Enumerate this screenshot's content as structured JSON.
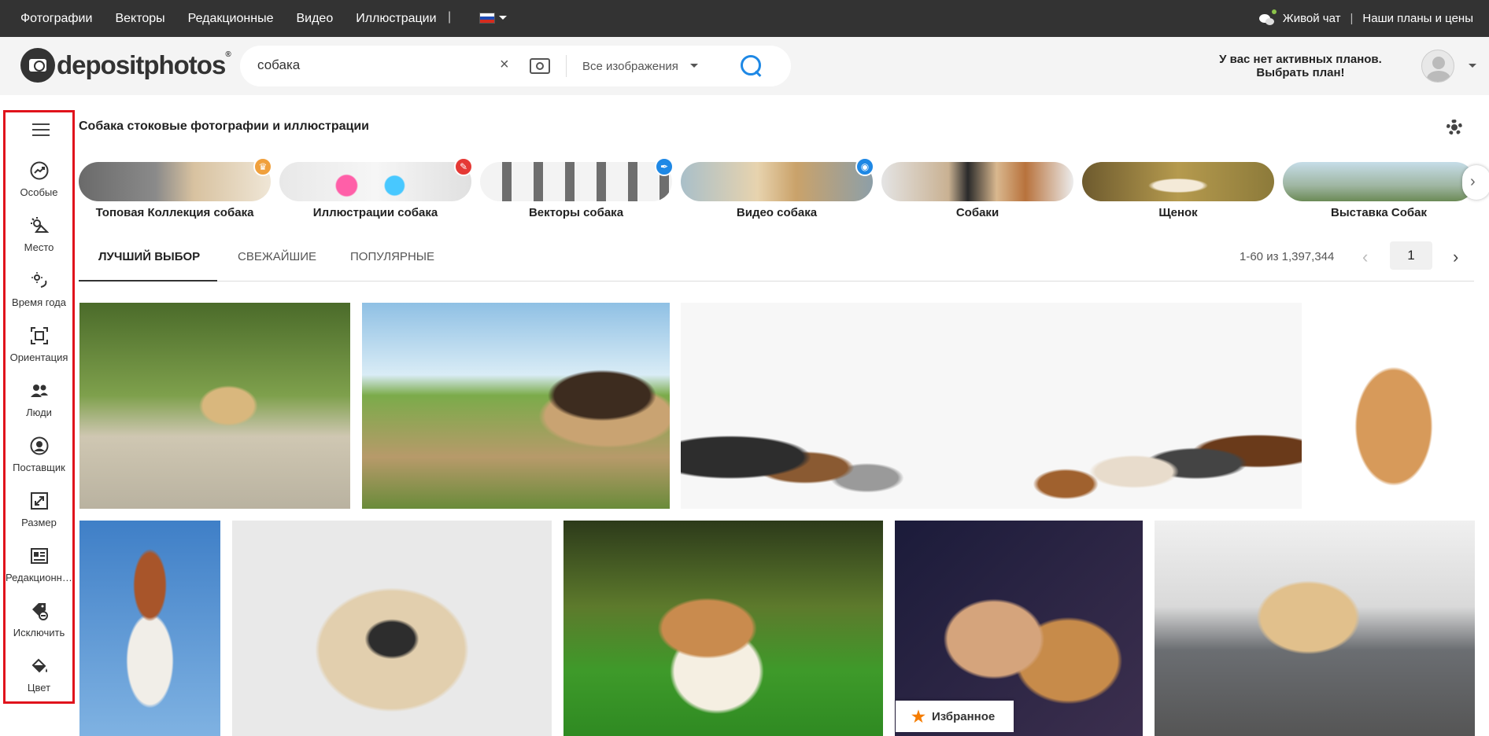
{
  "topnav": {
    "items": [
      "Фотографии",
      "Векторы",
      "Редакционные",
      "Видео",
      "Иллюстрации"
    ],
    "separator": "|",
    "live_chat": "Живой чат",
    "plans": "Наши планы и цены"
  },
  "header": {
    "logo_text": "depositphotos",
    "logo_mark": "®",
    "search_value": "собака",
    "clear_symbol": "×",
    "filter_label": "Все изображения",
    "plan_line1": "У вас нет активных планов.",
    "plan_line2": "Выбрать план!"
  },
  "sidebar": {
    "items": [
      {
        "label": "Особые",
        "icon": "trending-icon"
      },
      {
        "label": "Место",
        "icon": "weather-icon"
      },
      {
        "label": "Время года",
        "icon": "season-icon"
      },
      {
        "label": "Ориентация",
        "icon": "orientation-icon"
      },
      {
        "label": "Люди",
        "icon": "people-icon"
      },
      {
        "label": "Поставщик",
        "icon": "contributor-icon"
      },
      {
        "label": "Размер",
        "icon": "size-icon"
      },
      {
        "label": "Редакционное",
        "icon": "editorial-icon"
      },
      {
        "label": "Исключить",
        "icon": "exclude-icon"
      },
      {
        "label": "Цвет",
        "icon": "color-icon"
      }
    ]
  },
  "page_title": "Собака стоковые фотографии и иллюстрации",
  "categories": [
    {
      "label": "Топовая Коллекция собака",
      "badge": "crown-icon",
      "badge_color": "#f0a03c"
    },
    {
      "label": "Иллюстрации собака",
      "badge": "brush-icon",
      "badge_color": "#e53935"
    },
    {
      "label": "Векторы собака",
      "badge": "pen-icon",
      "badge_color": "#1e88e5"
    },
    {
      "label": "Видео собака",
      "badge": "camera-icon",
      "badge_color": "#1e88e5"
    },
    {
      "label": "Собаки",
      "badge": "",
      "badge_color": ""
    },
    {
      "label": "Щенок",
      "badge": "",
      "badge_color": ""
    },
    {
      "label": "Выставка Собак",
      "badge": "",
      "badge_color": ""
    }
  ],
  "tabs": [
    "ЛУЧШИЙ ВЫБОР",
    "СВЕЖАЙШИЕ",
    "ПОПУЛЯРНЫЕ"
  ],
  "pagination": {
    "count": "1-60 из 1,397,344",
    "page": "1",
    "prev": "‹",
    "next": "›"
  },
  "favorite_label": "Избранное",
  "colors": {
    "topbar": "#333333",
    "accent": "#1e88e5",
    "highlight_border": "#e0131c",
    "star": "#f57c00"
  }
}
